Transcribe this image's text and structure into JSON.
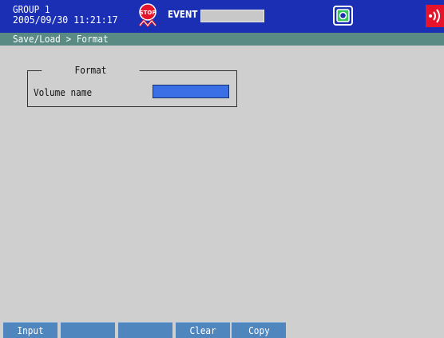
{
  "header": {
    "group_title": "GROUP 1",
    "datetime": "2005/09/30 11:21:17",
    "event_label": "EVENT",
    "event_value": "",
    "icons": {
      "stop": "stop-icon",
      "memory_card": "memory-card-icon",
      "alarm": "alarm-icon"
    },
    "colors": {
      "bar": "#1b2fb4",
      "alarm": "#e5142b",
      "stop": "#e5142b"
    }
  },
  "breadcrumb": {
    "text": "Save/Load > Format",
    "color": "#5a8a84"
  },
  "format_panel": {
    "title": "Format",
    "volume_label": "Volume name",
    "volume_value": "",
    "input_color": "#3a6fe5"
  },
  "softkeys": [
    {
      "label": "Input"
    },
    {
      "label": ""
    },
    {
      "label": ""
    },
    {
      "label": "Clear"
    },
    {
      "label": "Copy"
    }
  ],
  "softkey_color": "#4f86be",
  "background": "#cfcfcf"
}
